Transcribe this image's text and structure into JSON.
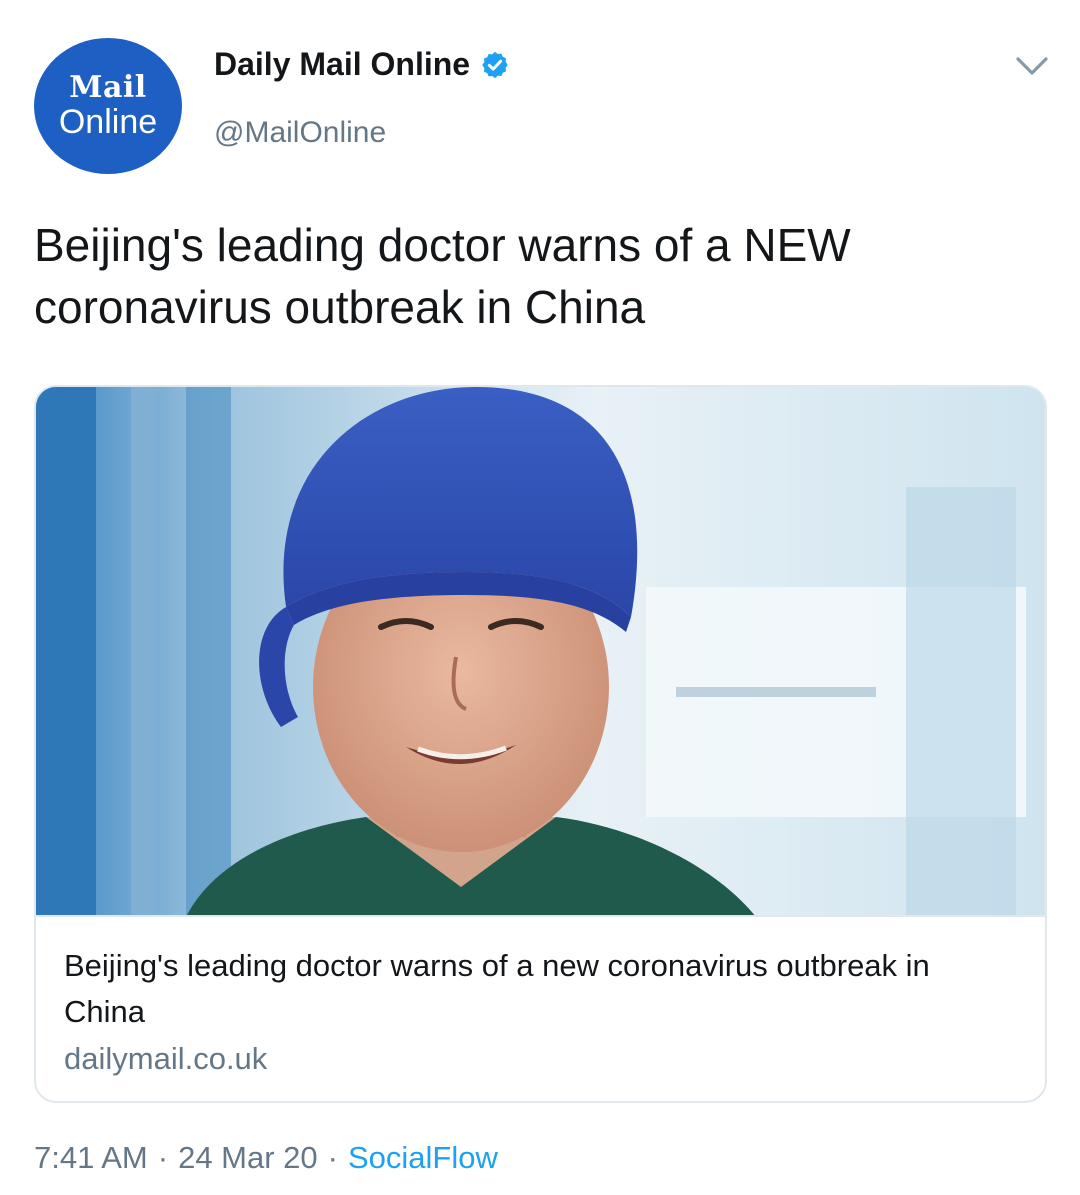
{
  "author": {
    "logo_line1": "Mail",
    "logo_line2": "Online",
    "display_name": "Daily Mail Online",
    "handle": "@MailOnline",
    "verified": true
  },
  "tweet": {
    "text": "Beijing's leading doctor warns of a NEW coronavirus outbreak in China"
  },
  "card": {
    "title": "Beijing's leading doctor warns of a new coronavirus outbreak in China",
    "domain": "dailymail.co.uk"
  },
  "meta": {
    "time": "7:41 AM",
    "separator": "·",
    "date": "24 Mar 20",
    "source": "SocialFlow"
  },
  "colors": {
    "brand_blue": "#1d5fc2",
    "verified_blue": "#1da1f2",
    "link_blue": "#1da1f2",
    "muted_gray": "#657786"
  }
}
